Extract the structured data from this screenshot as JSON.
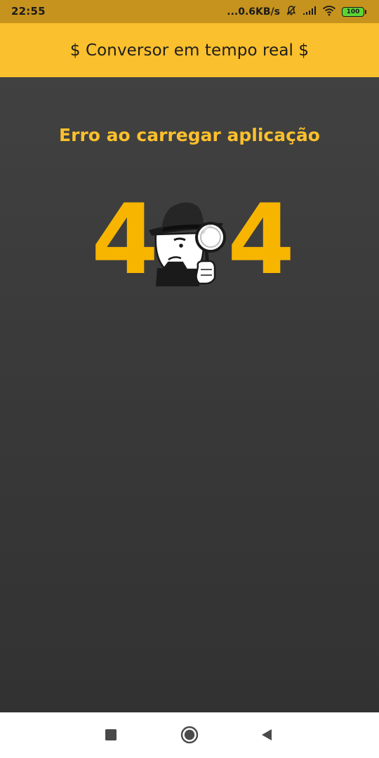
{
  "status_bar": {
    "time": "22:55",
    "network_speed": "...0.6KB/s",
    "battery_level": "100",
    "icons": [
      "mute-bell-icon",
      "signal-icon",
      "wifi-icon",
      "battery-icon"
    ]
  },
  "app_bar": {
    "title": "$ Conversor em tempo real $"
  },
  "main": {
    "error_message": "Erro ao carregar aplicação",
    "error_code_first": "4",
    "error_code_last": "4",
    "illustration_icon": "detective-magnifier-icon"
  },
  "nav_bar": {
    "icons": [
      "recents-square-icon",
      "home-circle-icon",
      "back-triangle-icon"
    ]
  },
  "colors": {
    "status_bar": "#c6931e",
    "app_bar": "#fbc02d",
    "accent_text": "#fbc02d",
    "digits": "#f7b500",
    "background": "#3a3a3a",
    "nav_bar": "#ffffff"
  }
}
